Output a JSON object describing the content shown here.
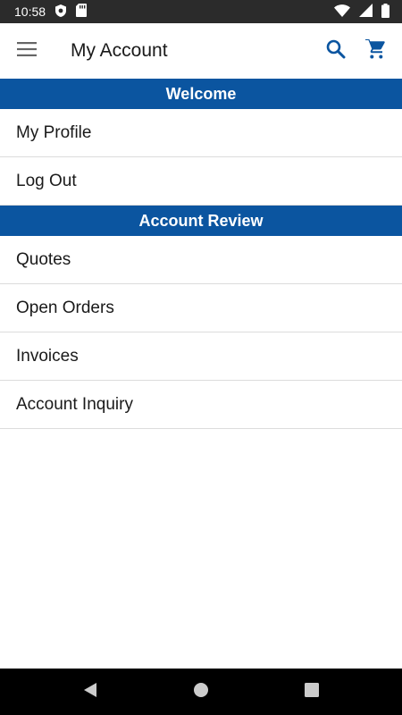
{
  "status_bar": {
    "time": "10:58",
    "icons": [
      "shield-icon",
      "sd-card-icon",
      "wifi-icon",
      "signal-icon",
      "battery-icon"
    ]
  },
  "app_bar": {
    "title": "My Account",
    "icons": [
      "menu-icon",
      "search-icon",
      "cart-icon"
    ],
    "accent_color": "#0b55a0"
  },
  "sections": [
    {
      "header": "Welcome",
      "items": [
        "My Profile",
        "Log Out"
      ]
    },
    {
      "header": "Account Review",
      "items": [
        "Quotes",
        "Open Orders",
        "Invoices",
        "Account Inquiry"
      ]
    }
  ],
  "nav_bar": {
    "icons": [
      "back-icon",
      "home-icon",
      "recents-icon"
    ]
  }
}
